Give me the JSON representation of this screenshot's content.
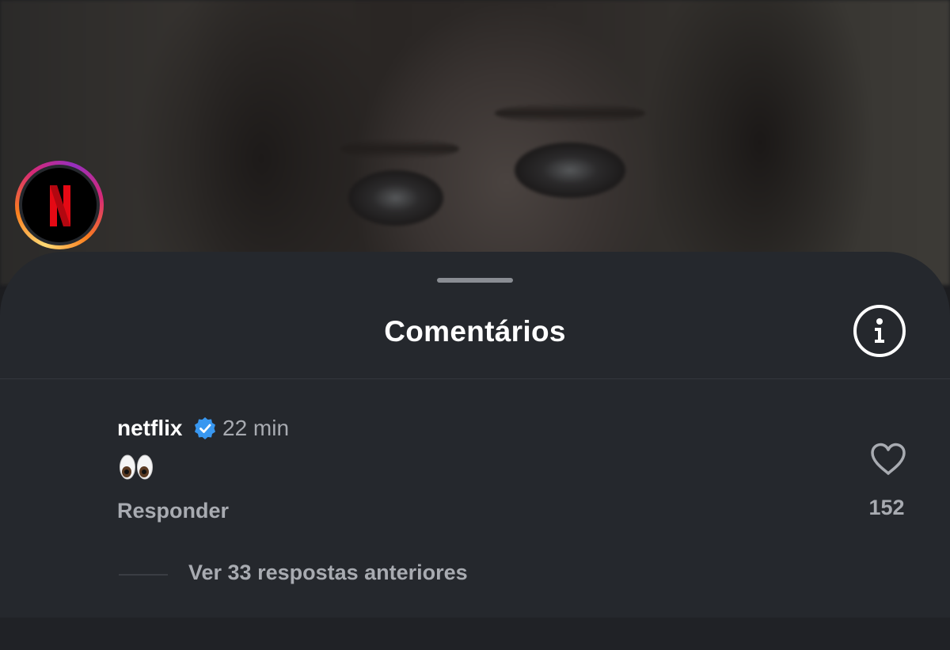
{
  "sheet": {
    "title": "Comentários",
    "info_icon": "info-circle-icon"
  },
  "comment": {
    "username": "netflix",
    "verified": true,
    "verified_color": "#3897f0",
    "timestamp": "22 min",
    "body": "👀",
    "reply_label": "Responder",
    "like_count": "152",
    "like_icon": "heart-outline-icon",
    "view_replies_label": "Ver 33 respostas anteriores",
    "avatar_brand_color": "#e50914",
    "avatar_icon": "netflix-logo-icon"
  }
}
